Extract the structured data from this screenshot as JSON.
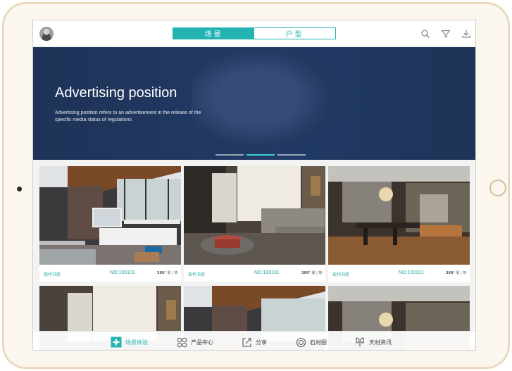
{
  "header": {
    "tabs": [
      {
        "label": "场景",
        "active": true
      },
      {
        "label": "户型",
        "active": false
      }
    ],
    "icons": [
      "search-icon",
      "filter-icon",
      "download-icon"
    ]
  },
  "banner": {
    "title": "Advertising position",
    "description": "Advertising position refers to an advertisement in the release of the specific media status of regulations",
    "slides": 3,
    "active_slide": 2
  },
  "cards": [
    {
      "category": "现代书房",
      "number": "NO:100101",
      "badge": "360°",
      "badge_detail": "景 | 热"
    },
    {
      "category": "现代书房",
      "number": "NO:100101",
      "badge": "360°",
      "badge_detail": "景 | 热"
    },
    {
      "category": "现代书房",
      "number": "NO:100101",
      "badge": "360°",
      "badge_detail": "景 | 热"
    }
  ],
  "bottom_nav": [
    {
      "label": "场景体验",
      "icon": "scene-icon",
      "active": true
    },
    {
      "label": "产品中心",
      "icon": "product-grid-icon",
      "active": false
    },
    {
      "label": "分享",
      "icon": "share-icon",
      "active": false
    },
    {
      "label": "石材圈",
      "icon": "stone-circle-icon",
      "active": false
    },
    {
      "label": "天材资讯",
      "icon": "news-icon",
      "active": false
    }
  ],
  "colors": {
    "accent": "#24b2b2",
    "banner_bg": "#1f3358",
    "device_frame": "#e8d3b9"
  }
}
